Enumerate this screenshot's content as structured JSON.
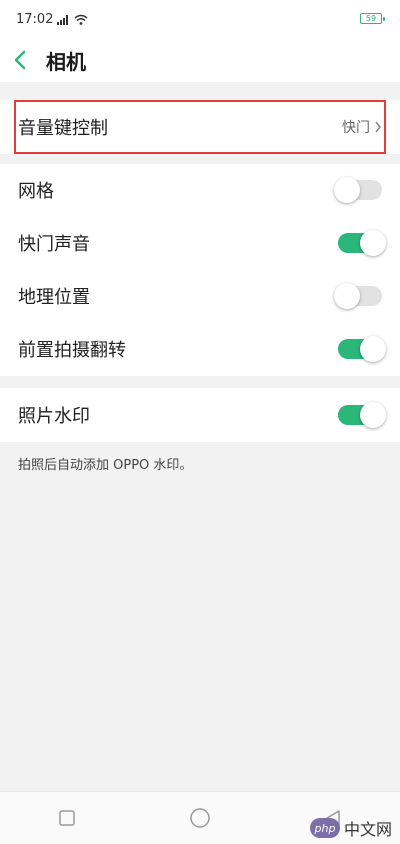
{
  "status_bar": {
    "time": "17:02",
    "battery": "59"
  },
  "header": {
    "title": "相机"
  },
  "volume_row": {
    "label": "音量键控制",
    "value": "快门"
  },
  "settings": [
    {
      "label": "网格",
      "on": false
    },
    {
      "label": "快门声音",
      "on": true
    },
    {
      "label": "地理位置",
      "on": false
    },
    {
      "label": "前置拍摄翻转",
      "on": true
    }
  ],
  "watermark_row": {
    "label": "照片水印",
    "on": true
  },
  "watermark_note": "拍照后自动添加 OPPO 水印。",
  "site_watermark": {
    "badge": "php",
    "text": "中文网"
  },
  "colors": {
    "accent": "#2bb67a",
    "highlight": "#e23c3c"
  }
}
